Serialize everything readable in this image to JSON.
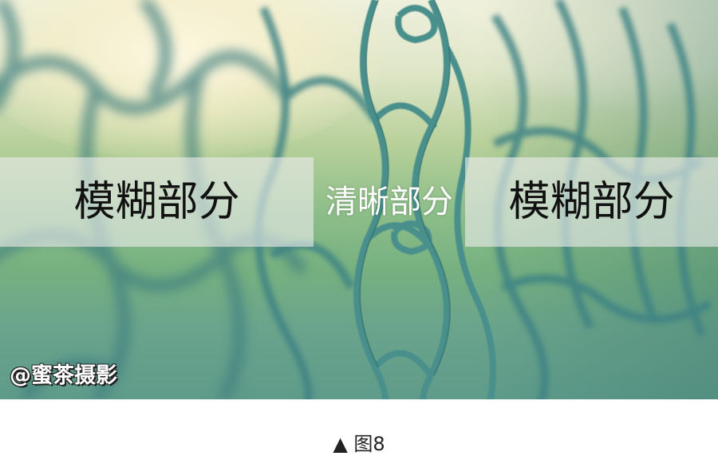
{
  "photo": {
    "description_labels": {
      "left": "模糊部分",
      "middle": "清晰部分",
      "right": "模糊部分"
    },
    "watermark": "@蜜茶摄影"
  },
  "caption": "▲ 图8"
}
